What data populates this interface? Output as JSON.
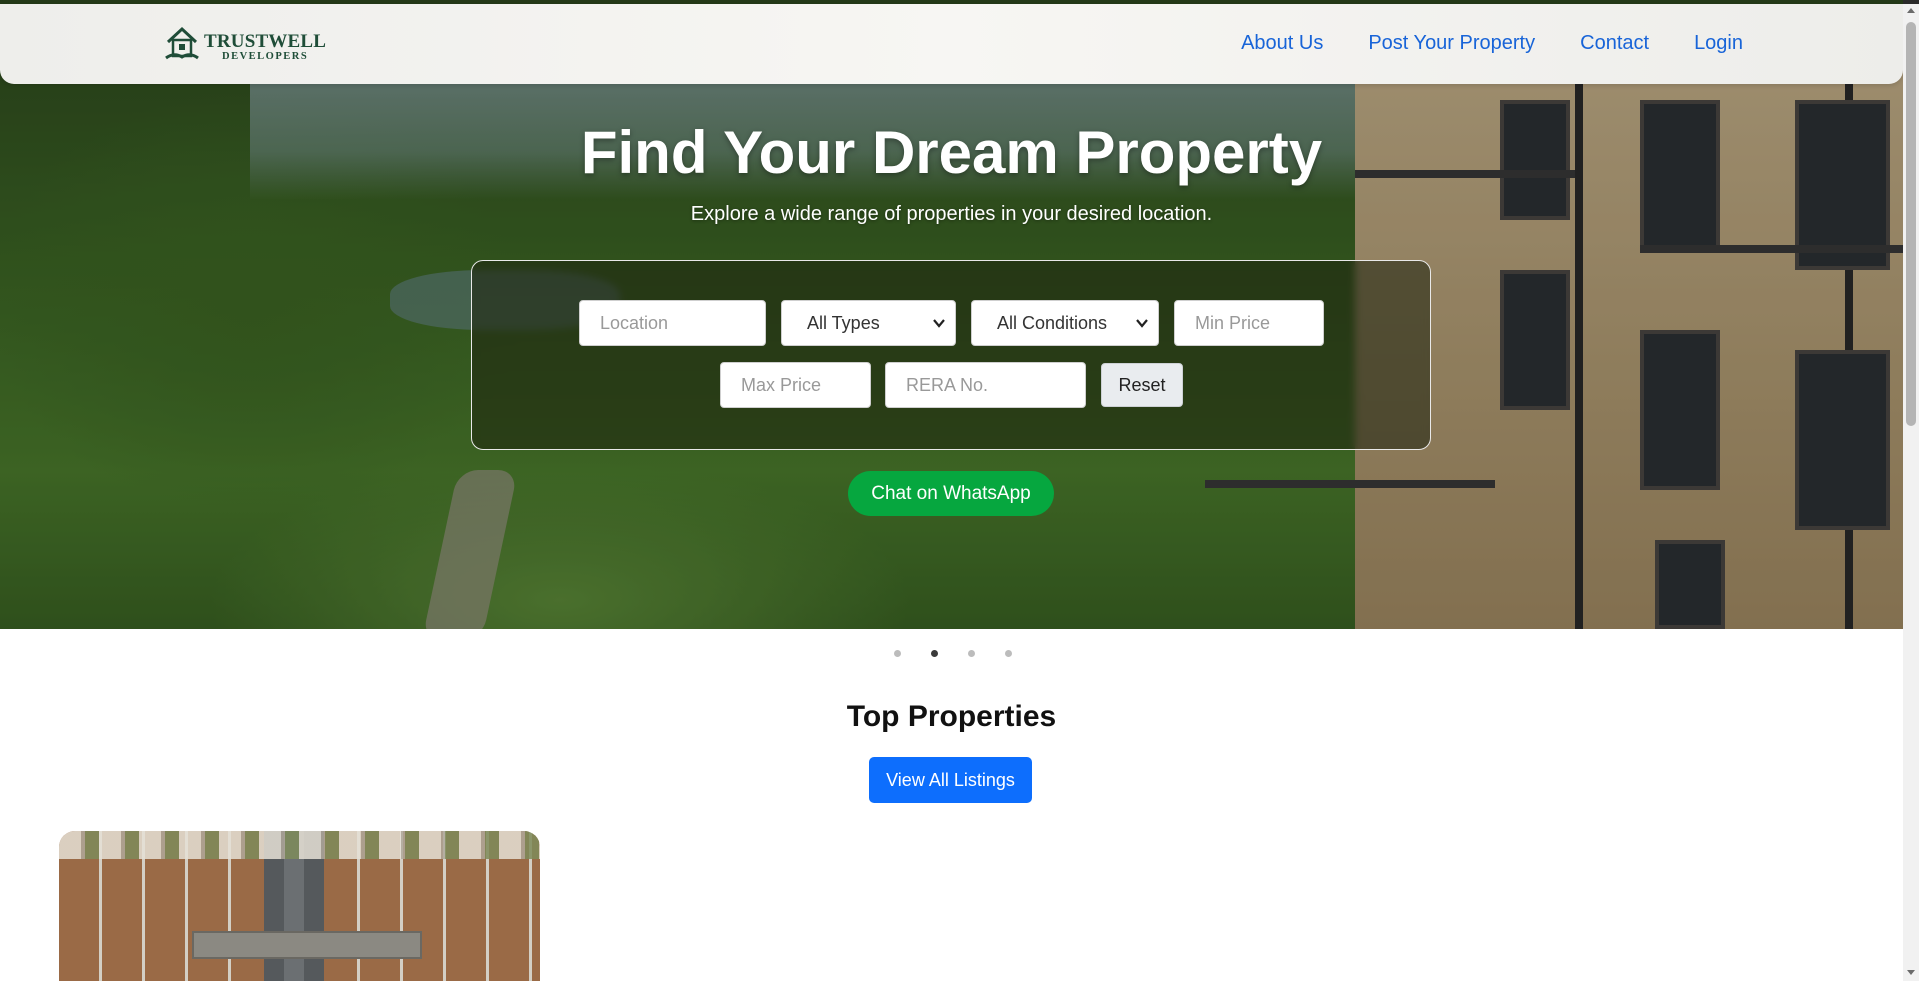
{
  "brand": {
    "name": "TRUSTWELL",
    "tagline": "DEVELOPERS",
    "color": "#1f4d38"
  },
  "nav": {
    "links": [
      "About Us",
      "Post Your Property",
      "Contact",
      "Login"
    ],
    "link_color": "#1864d8"
  },
  "hero": {
    "title": "Find Your Dream Property",
    "subtitle": "Explore a wide range of properties in your desired location."
  },
  "search": {
    "location_placeholder": "Location",
    "type_selected": "All Types",
    "condition_selected": "All Conditions",
    "min_price_placeholder": "Min Price",
    "max_price_placeholder": "Max Price",
    "rera_placeholder": "RERA No.",
    "reset_label": "Reset"
  },
  "whatsapp": {
    "label": "Chat on WhatsApp",
    "color": "#06a73f"
  },
  "carousel": {
    "slide_count": 4,
    "active_index": 1
  },
  "top_properties": {
    "title": "Top Properties",
    "view_all_label": "View All Listings",
    "button_color": "#0d6efd"
  }
}
